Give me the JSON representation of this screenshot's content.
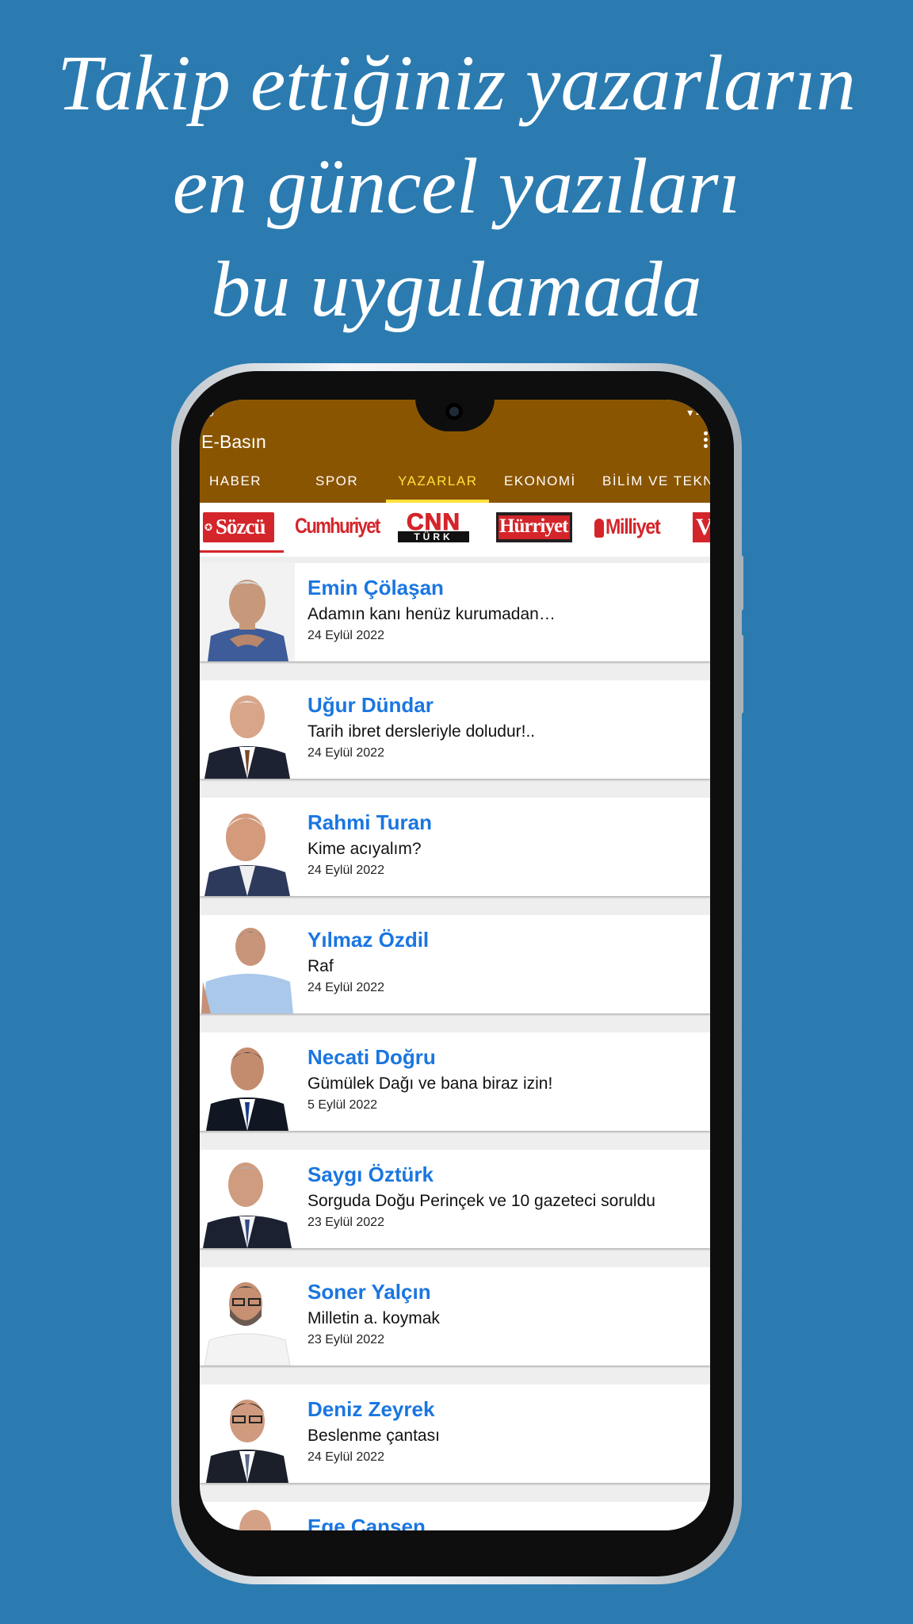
{
  "promo": {
    "line1": "Takip ettiğiniz yazarların",
    "line2": "en güncel yazıları",
    "line3": "bu uygulamada"
  },
  "status": {
    "left": "5",
    "right": "▾ 4"
  },
  "app": {
    "title": "E-Basın"
  },
  "tabs": [
    {
      "label": "HABER"
    },
    {
      "label": "SPOR"
    },
    {
      "label": "YAZARLAR"
    },
    {
      "label": "EKONOMİ"
    },
    {
      "label": "BİLİM VE TEKNOLOJİ"
    }
  ],
  "sources": [
    {
      "name": "Sözcü"
    },
    {
      "name": "Cumhuriyet"
    },
    {
      "name": "CNN"
    },
    {
      "name": "TÜRK"
    },
    {
      "name": "Hürriyet"
    },
    {
      "name": "Milliyet"
    },
    {
      "name": "V"
    }
  ],
  "articles": [
    {
      "author": "Emin Çölaşan",
      "title": "Adamın kanı henüz kurumadan…",
      "date": "24 Eylül 2022"
    },
    {
      "author": "Uğur Dündar",
      "title": "Tarih ibret dersleriyle doludur!..",
      "date": "24 Eylül 2022"
    },
    {
      "author": "Rahmi Turan",
      "title": "Kime acıyalım?",
      "date": "24 Eylül 2022"
    },
    {
      "author": "Yılmaz Özdil",
      "title": "Raf",
      "date": "24 Eylül 2022"
    },
    {
      "author": "Necati Doğru",
      "title": "Gümülek Dağı ve bana biraz izin!",
      "date": "5 Eylül 2022"
    },
    {
      "author": "Saygı Öztürk",
      "title": "Sorguda Doğu Perinçek ve 10 gazeteci soruldu",
      "date": "23 Eylül 2022"
    },
    {
      "author": "Soner Yalçın",
      "title": "Milletin a. koymak",
      "date": "23 Eylül 2022"
    },
    {
      "author": "Deniz Zeyrek",
      "title": "Beslenme çantası",
      "date": "24 Eylül 2022"
    },
    {
      "author": "Ege Cansen",
      "title": "",
      "date": ""
    }
  ],
  "colors": {
    "background": "#2b7bb0",
    "appbar": "#8a5500",
    "active_tab": "#ffe23c",
    "author_link": "#1a76e0"
  }
}
